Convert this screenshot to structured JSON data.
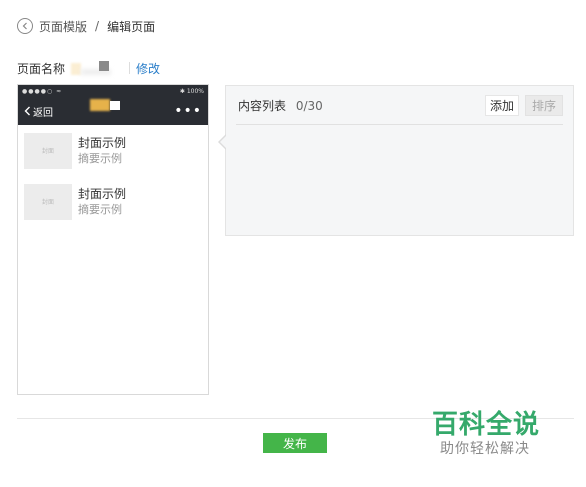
{
  "breadcrumb": {
    "parent": "页面模版",
    "separator": "/",
    "current": "编辑页面"
  },
  "page_name": {
    "label": "页面名称",
    "edit_link": "修改"
  },
  "phone": {
    "status_left": "●●●●○ ≈",
    "status_right": "✱ 100%",
    "back_label": "返回",
    "more_label": "•••",
    "articles": [
      {
        "thumb_label": "封面",
        "title": "封面示例",
        "desc": "摘要示例"
      },
      {
        "thumb_label": "封面",
        "title": "封面示例",
        "desc": "摘要示例"
      }
    ]
  },
  "content_panel": {
    "title": "内容列表",
    "count": "0/30",
    "add_button": "添加",
    "sort_button": "排序"
  },
  "publish_button": "发布",
  "watermark": {
    "title": "百科全说",
    "subtitle": "助你轻松解决"
  },
  "colors": {
    "accent_green": "#44b549",
    "link_blue": "#2a7ec9",
    "phone_header": "#2a2d33",
    "watermark_green": "#35a96b"
  }
}
